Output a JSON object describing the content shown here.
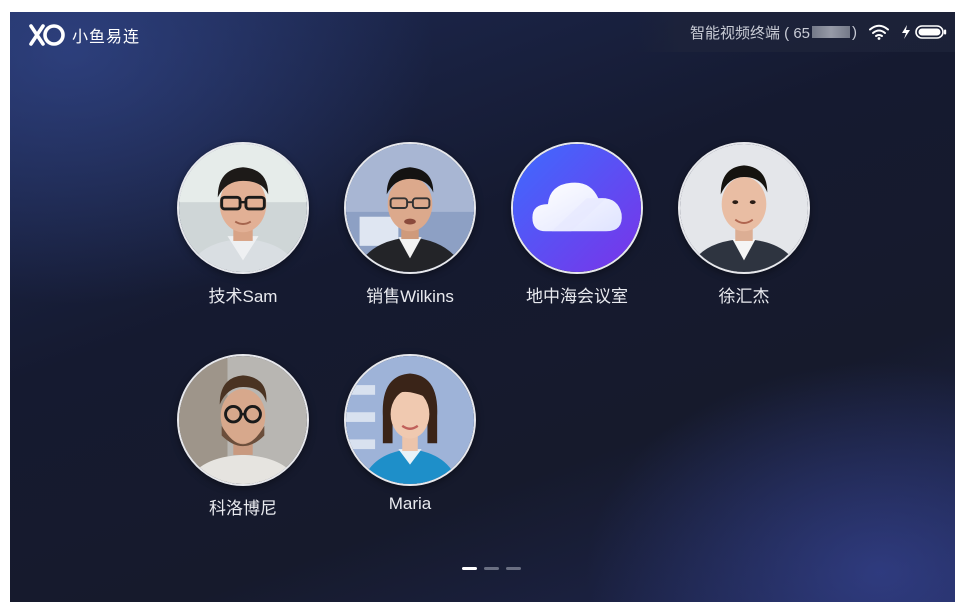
{
  "app": {
    "brand": "小鱼易连"
  },
  "status": {
    "device_prefix": "智能视频终端 ( 65",
    "device_suffix": " )",
    "wifi_icon": "wifi-icon",
    "charging_icon": "bolt-icon",
    "battery_icon": "battery-icon"
  },
  "contacts": [
    {
      "name": "技术Sam",
      "type": "person"
    },
    {
      "name": "销售Wilkins",
      "type": "person"
    },
    {
      "name": "地中海会议室",
      "type": "cloud-room",
      "icon": "cloud-icon",
      "color": "#6a3ff0"
    },
    {
      "name": "徐汇杰",
      "type": "person"
    },
    {
      "name": "科洛博尼",
      "type": "person"
    },
    {
      "name": "Maria",
      "type": "person"
    }
  ],
  "pager": {
    "page_count": 3,
    "current": 1
  }
}
